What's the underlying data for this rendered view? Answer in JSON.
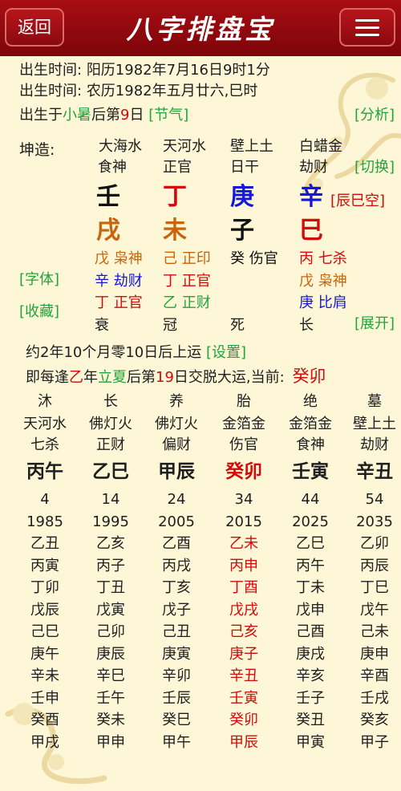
{
  "header": {
    "back_label": "返回",
    "title": "八字排盘宝"
  },
  "birth": {
    "solar_label": "出生时间:",
    "solar_value": "阳历1982年7月16日9时1分",
    "lunar_label": "出生时间:",
    "lunar_value": "农历1982年五月廿六,巳时",
    "term_prefix": "出生于",
    "term_name": "小暑",
    "term_mid": "后第",
    "term_day": "9",
    "term_suffix": "日",
    "term_link": "[节气]",
    "analysis_link": "[分析]"
  },
  "chart": {
    "gender_label": "坤造:",
    "switch_link": "[切换]",
    "void_link": "[辰巳空]",
    "font_link": "[字体]",
    "save_link": "[收藏]",
    "expand_link": "[展开]",
    "pillars": [
      {
        "nayin": "大海水",
        "ten_god": "食神",
        "stem": "壬",
        "stem_color": "#111111",
        "branch": "戌",
        "branch_color": "#c8640a",
        "hidden": [
          {
            "text": "戊 枭神",
            "color": "#c8640a"
          },
          {
            "text": "辛 劫财",
            "color": "#1218d6"
          },
          {
            "text": "丁 正官",
            "color": "#d10a0a"
          }
        ],
        "stage": "衰"
      },
      {
        "nayin": "天河水",
        "ten_god": "正官",
        "stem": "丁",
        "stem_color": "#d10a0a",
        "branch": "未",
        "branch_color": "#c8640a",
        "hidden": [
          {
            "text": "己 正印",
            "color": "#c8640a"
          },
          {
            "text": "丁 正官",
            "color": "#d10a0a"
          },
          {
            "text": "乙 正财",
            "color": "#21a33b"
          }
        ],
        "stage": "冠"
      },
      {
        "nayin": "壁上土",
        "ten_god": "日干",
        "stem": "庚",
        "stem_color": "#1218d6",
        "branch": "子",
        "branch_color": "#111111",
        "hidden": [
          {
            "text": "癸 伤官",
            "color": "#111111"
          }
        ],
        "stage": "死"
      },
      {
        "nayin": "白蜡金",
        "ten_god": "劫财",
        "stem": "辛",
        "stem_color": "#1218d6",
        "branch": "巳",
        "branch_color": "#d10a0a",
        "hidden": [
          {
            "text": "丙 七杀",
            "color": "#d10a0a"
          },
          {
            "text": "戊 枭神",
            "color": "#c8640a"
          },
          {
            "text": "庚 比肩",
            "color": "#1218d6"
          }
        ],
        "stage": "长"
      }
    ]
  },
  "luck": {
    "start_text": "约2年10个月零10日后上运",
    "settings_link": "[设置]",
    "rule_prefix": "即每逢",
    "rule_stem": "乙",
    "rule_mid": "年",
    "rule_term": "立夏",
    "rule_after": "后第",
    "rule_day": "19",
    "rule_suffix": "日交脱大运,当前:",
    "current": "癸卯",
    "columns": [
      {
        "stage": "沐",
        "nayin": "天河水",
        "ten_god": "七杀",
        "pillar": "丙午",
        "age": "4",
        "year": "1985",
        "current": false,
        "years": [
          "乙丑",
          "丙寅",
          "丁卯",
          "戊辰",
          "己巳",
          "庚午",
          "辛未",
          "壬申",
          "癸酉",
          "甲戌"
        ]
      },
      {
        "stage": "长",
        "nayin": "佛灯火",
        "ten_god": "正财",
        "pillar": "乙巳",
        "age": "14",
        "year": "1995",
        "current": false,
        "years": [
          "乙亥",
          "丙子",
          "丁丑",
          "戊寅",
          "己卯",
          "庚辰",
          "辛巳",
          "壬午",
          "癸未",
          "甲申"
        ]
      },
      {
        "stage": "养",
        "nayin": "佛灯火",
        "ten_god": "偏财",
        "pillar": "甲辰",
        "age": "24",
        "year": "2005",
        "current": false,
        "years": [
          "乙酉",
          "丙戌",
          "丁亥",
          "戊子",
          "己丑",
          "庚寅",
          "辛卯",
          "壬辰",
          "癸巳",
          "甲午"
        ]
      },
      {
        "stage": "胎",
        "nayin": "金箔金",
        "ten_god": "伤官",
        "pillar": "癸卯",
        "age": "34",
        "year": "2015",
        "current": true,
        "years": [
          "乙未",
          "丙申",
          "丁酉",
          "戊戌",
          "己亥",
          "庚子",
          "辛丑",
          "壬寅",
          "癸卯",
          "甲辰"
        ]
      },
      {
        "stage": "绝",
        "nayin": "金箔金",
        "ten_god": "食神",
        "pillar": "壬寅",
        "age": "44",
        "year": "2025",
        "current": false,
        "years": [
          "乙巳",
          "丙午",
          "丁未",
          "戊申",
          "己酉",
          "庚戌",
          "辛亥",
          "壬子",
          "癸丑",
          "甲寅"
        ]
      },
      {
        "stage": "墓",
        "nayin": "壁上土",
        "ten_god": "劫财",
        "pillar": "辛丑",
        "age": "54",
        "year": "2035",
        "current": false,
        "years": [
          "乙卯",
          "丙辰",
          "丁巳",
          "戊午",
          "己未",
          "庚申",
          "辛酉",
          "壬戌",
          "癸亥",
          "甲子"
        ]
      }
    ]
  },
  "colors": {
    "header": "#8f090e",
    "bg": "#fdf7d8",
    "red": "#d10a0a",
    "green": "#21a33b",
    "brown": "#c8640a",
    "blue": "#1218d6"
  }
}
